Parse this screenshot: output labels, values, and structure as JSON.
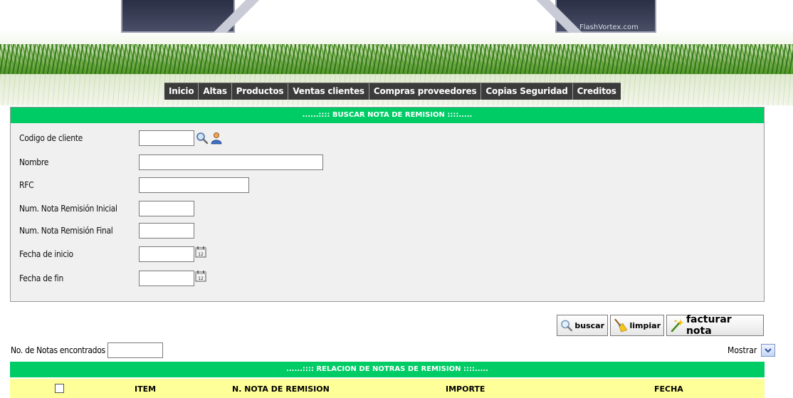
{
  "header": {
    "brand": "FlashVortex.com"
  },
  "nav": {
    "items": [
      "Inicio",
      "Altas",
      "Productos",
      "Ventas clientes",
      "Compras proveedores",
      "Copias Seguridad",
      "Creditos"
    ]
  },
  "search": {
    "title": "......:::: BUSCAR NOTA DE REMISION ::::.....",
    "fields": {
      "client_code": {
        "label": "Codigo de cliente",
        "value": ""
      },
      "name": {
        "label": "Nombre",
        "value": ""
      },
      "rfc": {
        "label": "RFC",
        "value": ""
      },
      "note_start": {
        "label": "Num. Nota Remisión Inicial",
        "value": ""
      },
      "note_end": {
        "label": "Num. Nota Remisión Final",
        "value": ""
      },
      "date_start": {
        "label": "Fecha de inicio",
        "value": ""
      },
      "date_end": {
        "label": "Fecha de fin",
        "value": ""
      }
    }
  },
  "actions": {
    "search": "buscar",
    "clear": "limpiar",
    "invoice": "facturar nota"
  },
  "results": {
    "count_label": "No. de Notas encontrados",
    "count_value": "",
    "show_label": "Mostrar",
    "title": "......:::: RELACION DE NOTRAS DE REMISION ::::.....",
    "columns": [
      "ITEM",
      "N. NOTA DE REMISION",
      "IMPORTE",
      "FECHA"
    ]
  },
  "colors": {
    "accent_green": "#00cc66",
    "header_yellow": "#ffff99",
    "nav_dark": "#3b3b3b"
  }
}
